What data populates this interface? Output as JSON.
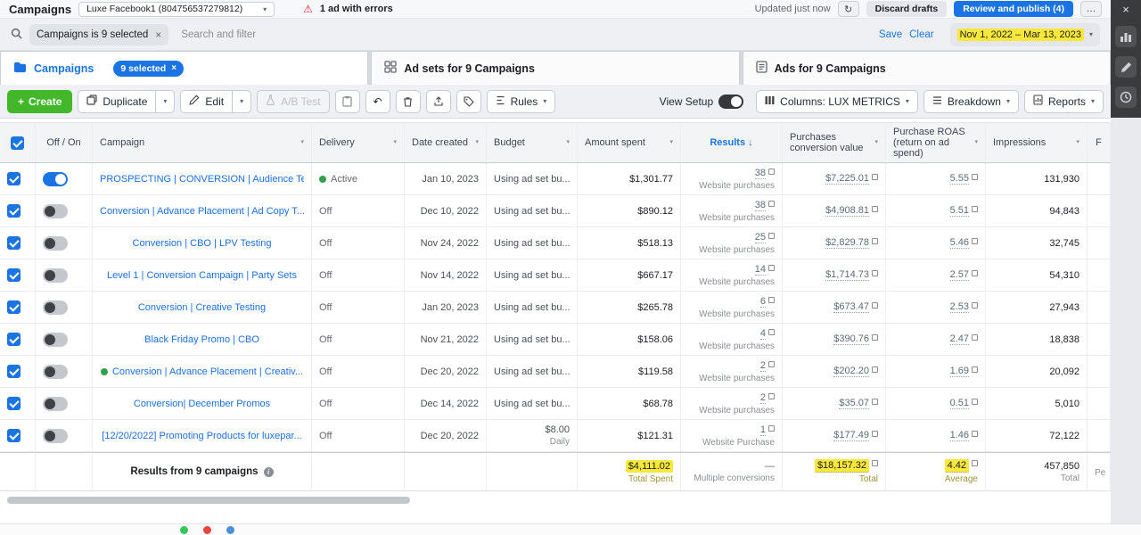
{
  "colors": {
    "accent_blue": "#1b74e4",
    "accent_green": "#42b72a",
    "highlight_yellow": "#f7e83b",
    "error_red": "#e41e3f",
    "active_green": "#31a24c"
  },
  "header": {
    "title": "Campaigns",
    "account": "Luxe Facebook1 (804756537279812)",
    "errors": "1 ad with errors",
    "updated": "Updated just now",
    "discard": "Discard drafts",
    "review": "Review and publish (4)",
    "more": "…"
  },
  "filter": {
    "chip": "Campaigns is 9 selected",
    "placeholder": "Search and filter",
    "save": "Save",
    "clear": "Clear",
    "date_range": "Nov 1, 2022 – Mar 13, 2023"
  },
  "tabs": {
    "campaigns": {
      "label": "Campaigns",
      "badge": "9 selected"
    },
    "adsets": {
      "label": "Ad sets for 9 Campaigns"
    },
    "ads": {
      "label": "Ads for 9 Campaigns"
    }
  },
  "toolbar": {
    "create": "Create",
    "duplicate": "Duplicate",
    "edit": "Edit",
    "ab_test": "A/B Test",
    "rules": "Rules",
    "view_setup": "View Setup",
    "columns": "Columns: LUX METRICS",
    "breakdown": "Breakdown",
    "reports": "Reports"
  },
  "table": {
    "columns": [
      {
        "label": "Off / On",
        "caret": false
      },
      {
        "label": "Campaign",
        "caret": true
      },
      {
        "label": "Delivery",
        "caret": true
      },
      {
        "label": "Date created",
        "caret": true
      },
      {
        "label": "Budget",
        "caret": true
      },
      {
        "label": "Amount spent",
        "caret": true
      },
      {
        "label": "Results",
        "caret": false,
        "sorted": true
      },
      {
        "label": "Purchases conversion value",
        "caret": true
      },
      {
        "label": "Purchase ROAS (return on ad spend)",
        "caret": true
      },
      {
        "label": "Impressions",
        "caret": true
      },
      {
        "label": "F",
        "caret": false
      }
    ],
    "rows": [
      {
        "name": "PROSPECTING | CONVERSION | Audience Te...",
        "on": true,
        "dot": false,
        "delivery": "Active",
        "active": true,
        "date": "Jan 10, 2023",
        "budget": "Using ad set bu...",
        "budget_sub": "",
        "spent": "$1,301.77",
        "results": "38",
        "results_sub": "Website purchases",
        "conv": "$7,225.01",
        "roas": "5.55",
        "impr": "131,930"
      },
      {
        "name": "Conversion | Advance Placement | Ad Copy T...",
        "on": false,
        "dot": false,
        "delivery": "Off",
        "active": false,
        "date": "Dec 10, 2022",
        "budget": "Using ad set bu...",
        "budget_sub": "",
        "spent": "$890.12",
        "results": "38",
        "results_sub": "Website purchases",
        "conv": "$4,908.81",
        "roas": "5.51",
        "impr": "94,843"
      },
      {
        "name": "Conversion | CBO | LPV Testing",
        "on": false,
        "dot": false,
        "delivery": "Off",
        "active": false,
        "date": "Nov 24, 2022",
        "budget": "Using ad set bu...",
        "budget_sub": "",
        "spent": "$518.13",
        "results": "25",
        "results_sub": "Website purchases",
        "conv": "$2,829.78",
        "roas": "5.46",
        "impr": "32,745"
      },
      {
        "name": "Level 1 | Conversion Campaign | Party Sets",
        "on": false,
        "dot": false,
        "delivery": "Off",
        "active": false,
        "date": "Nov 14, 2022",
        "budget": "Using ad set bu...",
        "budget_sub": "",
        "spent": "$667.17",
        "results": "14",
        "results_sub": "Website purchases",
        "conv": "$1,714.73",
        "roas": "2.57",
        "impr": "54,310"
      },
      {
        "name": "Conversion | Creative Testing",
        "on": false,
        "dot": false,
        "delivery": "Off",
        "active": false,
        "date": "Jan 20, 2023",
        "budget": "Using ad set bu...",
        "budget_sub": "",
        "spent": "$265.78",
        "results": "6",
        "results_sub": "Website purchases",
        "conv": "$673.47",
        "roas": "2.53",
        "impr": "27,943"
      },
      {
        "name": "Black Friday Promo | CBO",
        "on": false,
        "dot": false,
        "delivery": "Off",
        "active": false,
        "date": "Nov 21, 2022",
        "budget": "Using ad set bu...",
        "budget_sub": "",
        "spent": "$158.06",
        "results": "4",
        "results_sub": "Website purchases",
        "conv": "$390.76",
        "roas": "2.47",
        "impr": "18,838"
      },
      {
        "name": "Conversion | Advance Placement | Creativ...",
        "on": false,
        "dot": true,
        "delivery": "Off",
        "active": false,
        "date": "Dec 20, 2022",
        "budget": "Using ad set bu...",
        "budget_sub": "",
        "spent": "$119.58",
        "results": "2",
        "results_sub": "Website purchases",
        "conv": "$202.20",
        "roas": "1.69",
        "impr": "20,092"
      },
      {
        "name": "Conversion| December Promos",
        "on": false,
        "dot": false,
        "delivery": "Off",
        "active": false,
        "date": "Dec 14, 2022",
        "budget": "Using ad set bu...",
        "budget_sub": "",
        "spent": "$68.78",
        "results": "2",
        "results_sub": "Website purchases",
        "conv": "$35.07",
        "roas": "0.51",
        "impr": "5,010"
      },
      {
        "name": "[12/20/2022] Promoting Products for luxepar...",
        "on": false,
        "dot": false,
        "delivery": "Off",
        "active": false,
        "date": "Dec 20, 2022",
        "budget": "$8.00",
        "budget_sub": "Daily",
        "spent": "$121.31",
        "results": "1",
        "results_sub": "Website Purchase",
        "conv": "$177.49",
        "roas": "1.46",
        "impr": "72,122"
      }
    ],
    "footer": {
      "label": "Results from 9 campaigns",
      "spent": "$4,111.02",
      "spent_sub": "Total Spent",
      "results": "—",
      "results_sub": "Multiple conversions",
      "conv": "$18,157.32",
      "conv_sub": "Total",
      "roas": "4.42",
      "roas_sub": "Average",
      "impr": "457,850",
      "impr_sub": "Total",
      "last": "Pe"
    }
  }
}
